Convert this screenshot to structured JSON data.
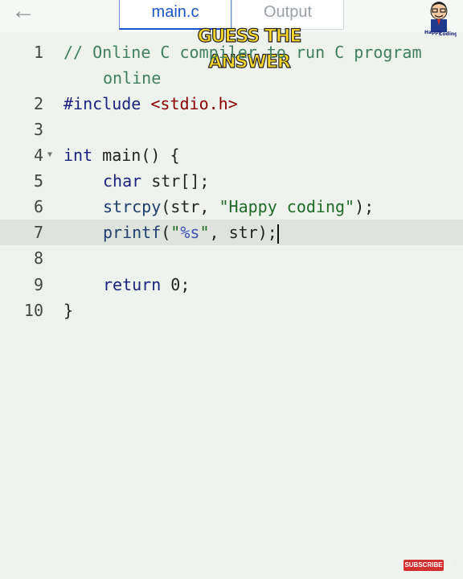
{
  "toolbar": {
    "back_icon": "arrow-left-icon",
    "tabs": [
      {
        "label": "main.c",
        "active": true
      },
      {
        "label": "Output",
        "active": false
      }
    ]
  },
  "overlay": {
    "title": "GUESS THE ANSWER",
    "mascot_icon": "happy-coding-mascot-icon"
  },
  "editor": {
    "active_line": 7,
    "lines": [
      {
        "num": "1",
        "text": "// Online C compiler to run C program"
      },
      {
        "num": "",
        "text": "    online"
      },
      {
        "num": "2",
        "text": "#include <stdio.h>"
      },
      {
        "num": "3",
        "text": ""
      },
      {
        "num": "4",
        "text": "int main() {"
      },
      {
        "num": "5",
        "text": "    char str[];"
      },
      {
        "num": "6",
        "text": "    strcpy(str, \"Happy coding\");"
      },
      {
        "num": "7",
        "text": "    printf(\"%s\", str);"
      },
      {
        "num": "8",
        "text": ""
      },
      {
        "num": "9",
        "text": "    return 0;"
      },
      {
        "num": "10",
        "text": "}"
      }
    ],
    "tokens": {
      "comment": "// Online C compiler to run C program",
      "comment_cont": "online",
      "include_kw": "#include",
      "include_file": "<stdio.h>",
      "int_kw": "int",
      "main_sig": " main() {",
      "char_kw": "char",
      "char_rest": " str[];",
      "strcpy_fn": "strcpy",
      "strcpy_args": "(str, ",
      "strcpy_str": "\"Happy coding\"",
      "strcpy_end": ");",
      "printf_fn": "printf",
      "printf_open": "(",
      "printf_q1": "\"",
      "printf_fmt": "%s",
      "printf_q2": "\"",
      "printf_rest": ", str);",
      "return_kw": "return",
      "return_rest": " 0;",
      "close_brace": "}"
    }
  },
  "footer": {
    "subscribe_label": "SUBSCRIBE",
    "hand_icon": "pointing-hand-icon"
  },
  "colors": {
    "background": "#eef2ec",
    "active_tab": "#1a56c7",
    "comment": "#3f7f5f",
    "keyword": "#1a237e",
    "string": "#1e6b26",
    "include": "#8b0000",
    "title": "#f7d52a"
  }
}
